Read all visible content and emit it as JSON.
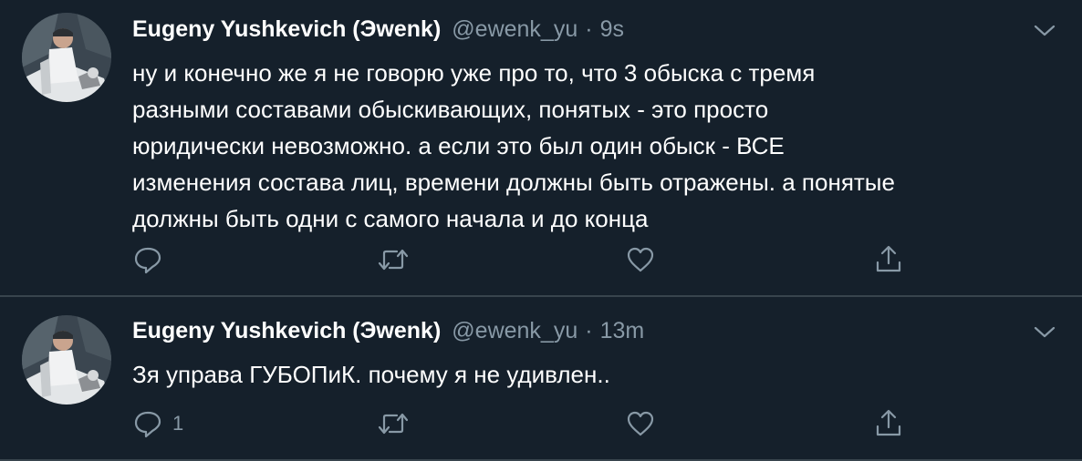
{
  "colors": {
    "background": "#15202b",
    "text_primary": "#ffffff",
    "text_secondary": "#8899a6",
    "divider": "#38444d"
  },
  "tweets": [
    {
      "author_name": "Eugeny Yushkevich (Эwenk)",
      "handle": "@ewenk_yu",
      "separator": "·",
      "time": "9s",
      "text_lines": [
        "ну и конечно же я не говорю уже про то, что 3 обыска с тремя",
        "разными составами обыскивающих, понятых - это просто",
        "юридически невозможно. а если это был один обыск - ВСЕ",
        "изменения состава лиц, времени должны быть отражены. а понятые",
        "должны быть одни с самого начала и до конца"
      ],
      "reply_count": "",
      "icons": [
        "reply-icon",
        "retweet-icon",
        "like-icon",
        "share-icon",
        "chevron-down-icon"
      ]
    },
    {
      "author_name": "Eugeny Yushkevich (Эwenk)",
      "handle": "@ewenk_yu",
      "separator": "·",
      "time": "13m",
      "text_lines": [
        "Зя управа ГУБОПиК. почему я не удивлен.."
      ],
      "reply_count": "1",
      "icons": [
        "reply-icon",
        "retweet-icon",
        "like-icon",
        "share-icon",
        "chevron-down-icon"
      ]
    }
  ]
}
